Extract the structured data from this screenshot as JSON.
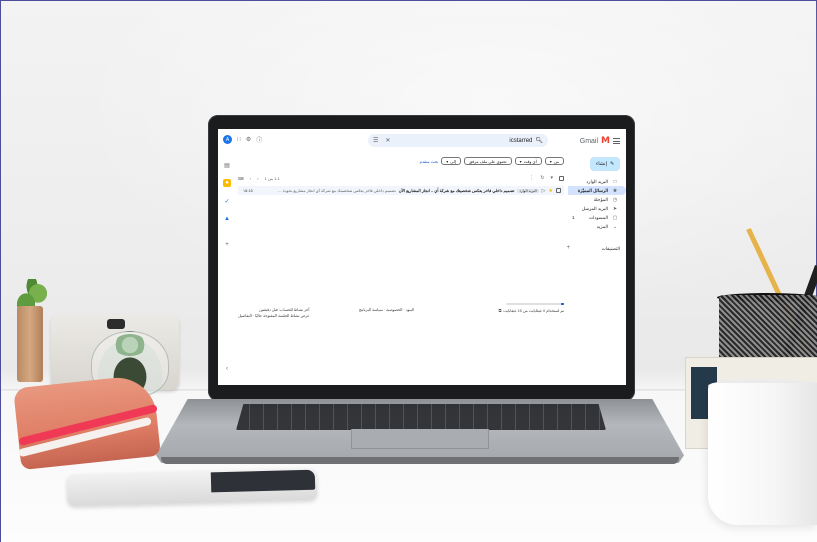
{
  "gmail": {
    "logo_text": "Gmail",
    "avatar_letter": "A",
    "search_query": "icstarred",
    "compose_label": "إنشاء",
    "nav_items": [
      {
        "label": "البريد الوارد",
        "count": "",
        "icon": "inbox-icon"
      },
      {
        "label": "الرسائل المميّزة",
        "count": "",
        "icon": "star-icon",
        "active": true
      },
      {
        "label": "المؤجلة",
        "count": "",
        "icon": "clock-icon"
      },
      {
        "label": "البريد المرسل",
        "count": "",
        "icon": "send-icon"
      },
      {
        "label": "المسودات",
        "count": "1",
        "icon": "draft-icon"
      },
      {
        "label": "المزيد",
        "count": "",
        "icon": "chevron-down-icon"
      }
    ],
    "labels_title": "التصنيفات",
    "filters": [
      {
        "label": "من"
      },
      {
        "label": "أي وقت"
      },
      {
        "label": "تحتوي على ملف مرفق"
      },
      {
        "label": "إلى"
      }
    ],
    "advanced_search_label": "بحث متقدم",
    "pagination": "1-1 من 1",
    "email": {
      "tag": "البريد الوارد",
      "subject": "تصميم داخلي فاخر يعكس شخصيتك مع شركة أي – انجاز المشاريع الآن",
      "snippet": "تصميم داخلي فاخر يعكس شخصيتك مع شركة أي انجاز مشاريع بجودة عالية في وقت قياسي ...",
      "date": "١٥:٤٥"
    },
    "footer": {
      "storage_text": "تم استخدام 0 غيغابايت من 15 غيغابايت",
      "terms_text": "البنود · الخصوصية · سياسة البرنامج",
      "activity_line1": "آخر نشاط للحساب: قبل دقيقتين",
      "activity_line2": "عرض نشاط الجلسة المفتوحة حاليًا · التفاصيل"
    }
  },
  "colors": {
    "accent_blue": "#0b57d0",
    "compose_bg": "#c2e7ff",
    "nav_active": "#d3e3fd",
    "search_bg": "#eaf1fb",
    "gmail_red": "#ea4335"
  },
  "storage_used_fraction": 0.06
}
